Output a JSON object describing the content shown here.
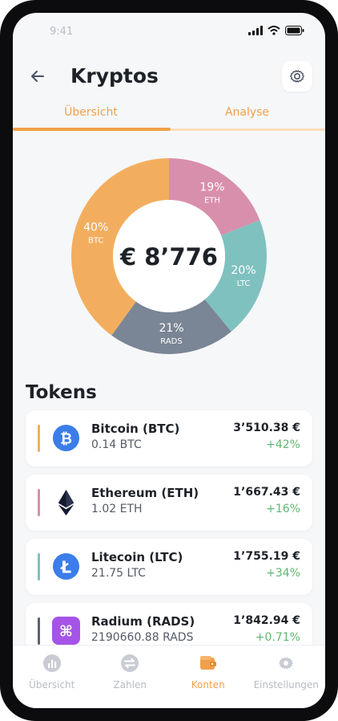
{
  "status": {
    "time": "9:41"
  },
  "header": {
    "title": "Kryptos",
    "back_icon": "arrow-left-icon",
    "settings_icon": "gear-icon"
  },
  "tabs": [
    {
      "label": "Übersicht",
      "active": true
    },
    {
      "label": "Analyse",
      "active": false
    }
  ],
  "portfolio": {
    "total": "€ 8’776",
    "slices": [
      {
        "label": "ETH",
        "pct": "19%",
        "value": 19,
        "color": "#d88fab"
      },
      {
        "label": "LTC",
        "pct": "20%",
        "value": 20,
        "color": "#7fc1bf"
      },
      {
        "label": "RADS",
        "pct": "21%",
        "value": 21,
        "color": "#7a8595"
      },
      {
        "label": "BTC",
        "pct": "40%",
        "value": 40,
        "color": "#f2ae5e"
      }
    ]
  },
  "tokens": {
    "heading": "Tokens",
    "items": [
      {
        "name": "Bitcoin (BTC)",
        "amount": "0.14 BTC",
        "value": "3’510.38 €",
        "change": "+42%",
        "color": "#f2ae5e",
        "icon": "bitcoin-icon"
      },
      {
        "name": "Ethereum (ETH)",
        "amount": "1.02 ETH",
        "value": "1’667.43 €",
        "change": "+16%",
        "color": "#d88fab",
        "icon": "ethereum-icon"
      },
      {
        "name": "Litecoin (LTC)",
        "amount": "21.75 LTC",
        "value": "1’755.19 €",
        "change": "+34%",
        "color": "#7fc1bf",
        "icon": "litecoin-icon"
      },
      {
        "name": "Radium (RADS)",
        "amount": "2190660.88 RADS",
        "value": "1’842.94 €",
        "change": "+0.71%",
        "color": "#5a6270",
        "icon": "radium-icon"
      }
    ]
  },
  "nav": [
    {
      "label": "Übersicht",
      "icon": "chart-icon",
      "active": false
    },
    {
      "label": "Zahlen",
      "icon": "transfer-icon",
      "active": false
    },
    {
      "label": "Konten",
      "icon": "wallet-icon",
      "active": true
    },
    {
      "label": "Einstellungen",
      "icon": "gear-icon",
      "active": false
    }
  ]
}
